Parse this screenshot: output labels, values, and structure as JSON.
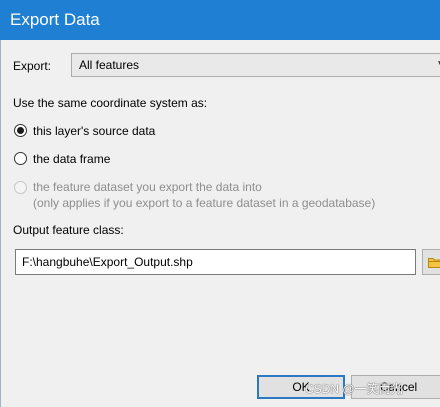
{
  "window": {
    "title": "Export Data"
  },
  "export": {
    "label": "Export:",
    "selected": "All features",
    "arrow_icon": "chevron-down-icon"
  },
  "coordinate_system": {
    "heading": "Use the same coordinate system as:",
    "options": [
      {
        "label": "this layer's source data",
        "checked": true,
        "enabled": true
      },
      {
        "label": "the data frame",
        "checked": false,
        "enabled": true
      },
      {
        "label": "the feature dataset you export the data into",
        "note": "(only applies if you export to a feature dataset in a geodatabase)",
        "checked": false,
        "enabled": false
      }
    ]
  },
  "output": {
    "label": "Output feature class:",
    "value": "F:\\hangbuhe\\Export_Output.shp",
    "browse_icon": "folder-icon"
  },
  "buttons": {
    "ok": "OK",
    "cancel": "Cancel"
  },
  "watermark": "CSDN @一笑而光"
}
